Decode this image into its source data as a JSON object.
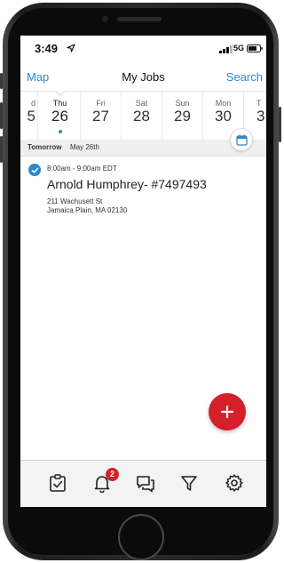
{
  "status_bar": {
    "time": "3:49",
    "network": "5G"
  },
  "nav": {
    "left_label": "Map",
    "title": "My Jobs",
    "right_label": "Search"
  },
  "date_strip": {
    "days": [
      {
        "name": "d",
        "num": "5"
      },
      {
        "name": "Thu",
        "num": "26"
      },
      {
        "name": "Fri",
        "num": "27"
      },
      {
        "name": "Sat",
        "num": "28"
      },
      {
        "name": "Sun",
        "num": "29"
      },
      {
        "name": "Mon",
        "num": "30"
      },
      {
        "name": "T",
        "num": "3"
      }
    ],
    "selected_index": 1
  },
  "section": {
    "label_bold": "Tomorrow",
    "label_rest": "May 26th"
  },
  "jobs": [
    {
      "time": "8:00am - 9:00am EDT",
      "name": "Arnold Humphrey- #7497493",
      "address_line1": "211 Wachusett St",
      "address_line2": "Jamaica Plain, MA 02130",
      "completed": true
    }
  ],
  "tab_bar": {
    "tabs": [
      "jobs-clipboard-icon",
      "notifications-bell-icon",
      "messages-icon",
      "filter-icon",
      "settings-gear-icon"
    ],
    "notification_badge": "2"
  },
  "colors": {
    "accent": "#2f86c8",
    "danger": "#d4202a"
  },
  "icons": {
    "fab": "plus-icon",
    "calendar": "calendar-icon",
    "location": "location-arrow-icon"
  }
}
